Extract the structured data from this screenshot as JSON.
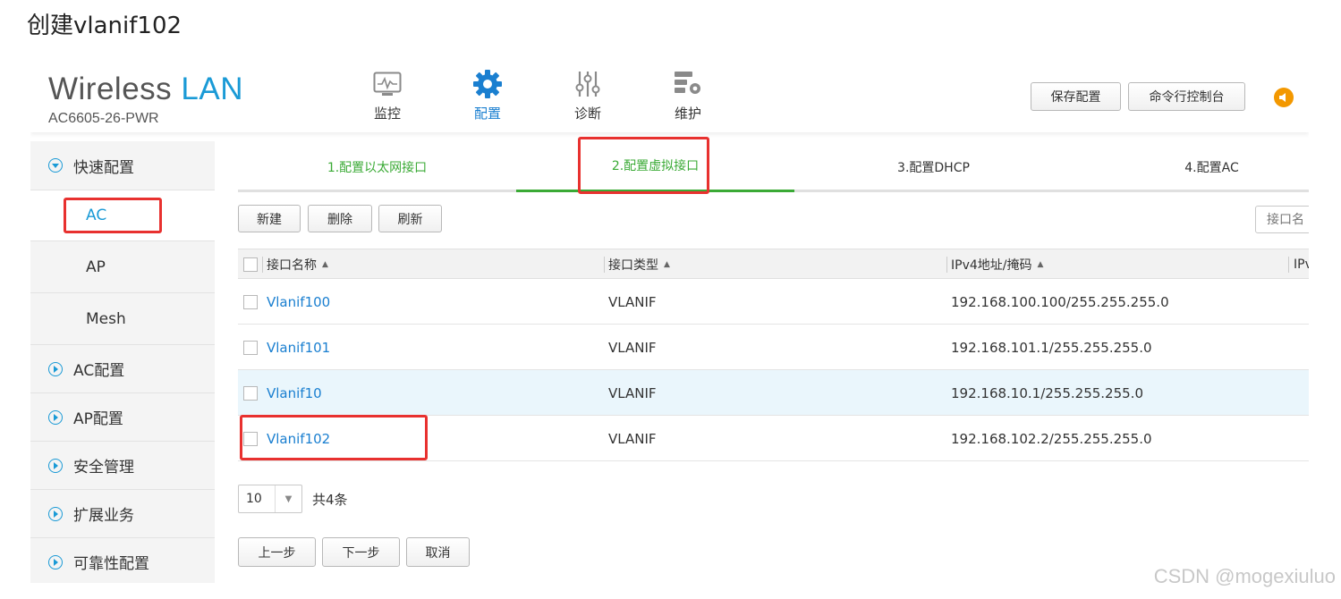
{
  "caption": "创建vlanif102",
  "header": {
    "brand_main": "Wireless",
    "brand_accent": "LAN",
    "model": "AC6605-26-PWR",
    "nav": [
      {
        "label": "监控",
        "icon": "monitor-icon"
      },
      {
        "label": "配置",
        "icon": "gear-icon"
      },
      {
        "label": "诊断",
        "icon": "sliders-icon"
      },
      {
        "label": "维护",
        "icon": "server-gear-icon"
      }
    ],
    "save_config": "保存配置",
    "cli_console": "命令行控制台"
  },
  "sidebar": {
    "items": [
      {
        "label": "快速配置",
        "expanded": true
      },
      {
        "label": "AC",
        "sub": true,
        "selected": true
      },
      {
        "label": "AP",
        "sub": true
      },
      {
        "label": "Mesh",
        "sub": true
      },
      {
        "label": "AC配置"
      },
      {
        "label": "AP配置"
      },
      {
        "label": "安全管理"
      },
      {
        "label": "扩展业务"
      },
      {
        "label": "可靠性配置"
      }
    ]
  },
  "steps": [
    "1.配置以太网接口",
    "2.配置虚拟接口",
    "3.配置DHCP",
    "4.配置AC"
  ],
  "toolbar": {
    "new": "新建",
    "delete": "删除",
    "refresh": "刷新",
    "search_placeholder": "接口名"
  },
  "table": {
    "headers": [
      "接口名称",
      "接口类型",
      "IPv4地址/掩码",
      "IPv"
    ],
    "rows": [
      {
        "name": "Vlanif100",
        "type": "VLANIF",
        "ipv4": "192.168.100.100/255.255.255.0"
      },
      {
        "name": "Vlanif101",
        "type": "VLANIF",
        "ipv4": "192.168.101.1/255.255.255.0"
      },
      {
        "name": "Vlanif10",
        "type": "VLANIF",
        "ipv4": "192.168.10.1/255.255.255.0"
      },
      {
        "name": "Vlanif102",
        "type": "VLANIF",
        "ipv4": "192.168.102.2/255.255.255.0"
      }
    ]
  },
  "pager": {
    "page_size": "10",
    "total": "共4条"
  },
  "footer_buttons": {
    "prev": "上一步",
    "next": "下一步",
    "cancel": "取消"
  },
  "watermark": "CSDN @mogexiuluo",
  "colors": {
    "brand_blue": "#1a9ad6",
    "step_green": "#3aaa35",
    "annotation_red": "#e8312f",
    "speaker_orange": "#f39800",
    "row_highlight": "#eaf6fc"
  }
}
